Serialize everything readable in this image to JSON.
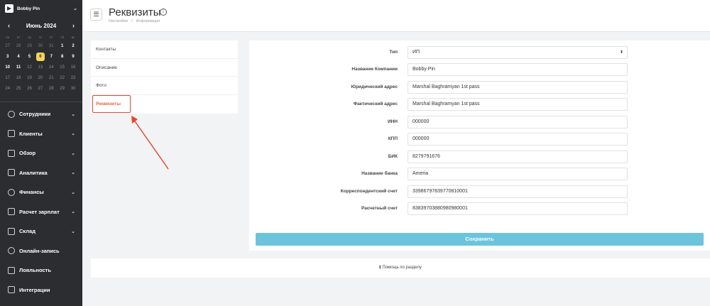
{
  "company": {
    "name": "Bobby Pin"
  },
  "calendar": {
    "month_label": "Июнь 2024",
    "weekdays": [
      "пн",
      "вт",
      "ср",
      "чт",
      "пт",
      "сб",
      "вс"
    ],
    "weeks": [
      [
        {
          "d": "27",
          "s": "dim"
        },
        {
          "d": "28",
          "s": "dim"
        },
        {
          "d": "29",
          "s": "dim"
        },
        {
          "d": "30",
          "s": "dim"
        },
        {
          "d": "31",
          "s": "dim"
        },
        {
          "d": "1",
          "s": ""
        },
        {
          "d": "2",
          "s": ""
        }
      ],
      [
        {
          "d": "3",
          "s": ""
        },
        {
          "d": "4",
          "s": ""
        },
        {
          "d": "5",
          "s": ""
        },
        {
          "d": "6",
          "s": "today"
        },
        {
          "d": "7",
          "s": ""
        },
        {
          "d": "8",
          "s": ""
        },
        {
          "d": "9",
          "s": ""
        }
      ],
      [
        {
          "d": "10",
          "s": ""
        },
        {
          "d": "11",
          "s": ""
        },
        {
          "d": "12",
          "s": "muted"
        },
        {
          "d": "13",
          "s": "muted"
        },
        {
          "d": "14",
          "s": "muted"
        },
        {
          "d": "15",
          "s": "muted"
        },
        {
          "d": "16",
          "s": "muted"
        }
      ],
      [
        {
          "d": "17",
          "s": "muted"
        },
        {
          "d": "18",
          "s": "muted"
        },
        {
          "d": "19",
          "s": "muted"
        },
        {
          "d": "20",
          "s": "muted"
        },
        {
          "d": "21",
          "s": "muted"
        },
        {
          "d": "22",
          "s": "muted"
        },
        {
          "d": "23",
          "s": "muted"
        }
      ],
      [
        {
          "d": "24",
          "s": "muted"
        },
        {
          "d": "25",
          "s": "muted"
        },
        {
          "d": "26",
          "s": "muted"
        },
        {
          "d": "27",
          "s": "muted"
        },
        {
          "d": "28",
          "s": "muted"
        },
        {
          "d": "29",
          "s": "muted"
        },
        {
          "d": "30",
          "s": "muted"
        }
      ]
    ]
  },
  "menu": [
    {
      "label": "Сотрудники",
      "icon": "user-icon",
      "chevron": true
    },
    {
      "label": "Клиенты",
      "icon": "users-icon",
      "chevron": true
    },
    {
      "label": "Обзор",
      "icon": "grid-icon",
      "chevron": true
    },
    {
      "label": "Аналитика",
      "icon": "chart-icon",
      "chevron": true
    },
    {
      "label": "Финансы",
      "icon": "dollar-icon",
      "chevron": true
    },
    {
      "label": "Расчет зарплат",
      "icon": "wallet-icon",
      "chevron": true
    },
    {
      "label": "Склад",
      "icon": "box-icon",
      "chevron": true
    },
    {
      "label": "Онлайн-запись",
      "icon": "globe-icon",
      "chevron": false
    },
    {
      "label": "Лояльность",
      "icon": "percent-icon",
      "chevron": false
    },
    {
      "label": "Интеграции",
      "icon": "integration-icon",
      "chevron": false
    }
  ],
  "header": {
    "title": "Реквизиты",
    "breadcrumb": [
      "Настройки",
      "Информация"
    ]
  },
  "tabs": [
    {
      "label": "Контакты",
      "active": false
    },
    {
      "label": "Описание",
      "active": false
    },
    {
      "label": "Фото",
      "active": false
    },
    {
      "label": "Реквизиты",
      "active": true
    }
  ],
  "form": {
    "type": {
      "label": "Тип",
      "value": "ИП"
    },
    "fields": [
      {
        "label": "Название Компании",
        "value": "Bobby Pin"
      },
      {
        "label": "Юридический адрес",
        "value": "Marshal Baghramyan 1st pass"
      },
      {
        "label": "Фактический адрес",
        "value": "Marshal Baghramyan 1st pass"
      },
      {
        "label": "ИНН",
        "value": "000000"
      },
      {
        "label": "КПП",
        "value": "000000"
      },
      {
        "label": "БИК",
        "value": "8279791676"
      },
      {
        "label": "Название банка",
        "value": "Ameria"
      },
      {
        "label": "Корреспондентский счет",
        "value": "33986797839770810001"
      },
      {
        "label": "Расчетный счет",
        "value": "83839703880980980001"
      }
    ],
    "save_label": "Сохранить"
  },
  "help": {
    "label": "Помощь по разделу"
  },
  "colors": {
    "accent": "#e8643a",
    "highlight": "#e8452f",
    "save": "#6cc4dc",
    "today": "#f6d35b",
    "sidebar": "#2b2d30"
  }
}
